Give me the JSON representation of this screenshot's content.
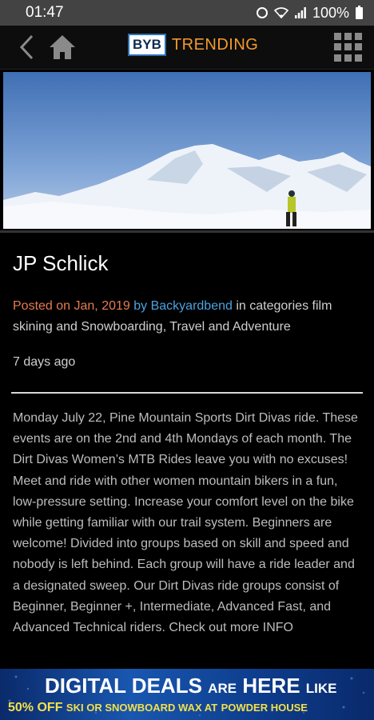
{
  "status_bar": {
    "time": "01:47",
    "battery": "100%"
  },
  "app_bar": {
    "logo": "BYB",
    "title": "TRENDING"
  },
  "post": {
    "title": "JP Schlick",
    "posted_on": "Posted on Jan, 2019",
    "by": "by",
    "author": "Backyardbend",
    "categories_text": "in categories film skining and Snowboarding, Travel and Adventure",
    "time_ago": "7 days ago",
    "body": "Monday July 22, Pine Mountain Sports Dirt Divas ride. These events are on the 2nd and 4th Mondays of each month. The Dirt Divas Women’s MTB Rides leave you with no excuses! Meet and ride with other women mountain bikers in a fun, low-pressure setting. Increase your comfort level on the bike while getting familiar with our trail system. Beginners are welcome! Divided into groups based on skill and speed and nobody is left behind. Each group will have a ride leader and a designated sweep. Our Dirt Divas ride groups consist of Beginner, Beginner +, Intermediate, Advanced Fast, and Advanced Technical riders. Check out more INFO"
  },
  "ad": {
    "line1_a": "DIGITAL DEALS",
    "line1_b": "ARE",
    "line1_c": "HERE",
    "line1_d": "LIKE",
    "line2_a": "50% OFF",
    "line2_b": "SKI OR SNOWBOARD WAX AT",
    "line2_c": "POWDER HOUSE"
  },
  "icons": [
    "alarm-icon",
    "wifi-icon",
    "signal-icon",
    "battery-icon",
    "back-icon",
    "home-icon",
    "grid-menu-icon"
  ],
  "colors": {
    "posted": "#e77b4f",
    "link": "#4aa3df",
    "brand_title": "#f39a2b",
    "ad_bg": "#1957b0",
    "ad_yellow": "#f3e04a"
  }
}
